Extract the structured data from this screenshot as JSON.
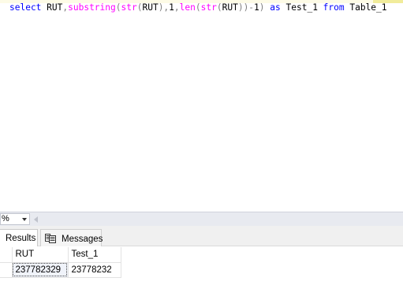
{
  "editor": {
    "query_tokens": [
      {
        "text": "select",
        "kind": "kw"
      },
      {
        "text": " RUT",
        "kind": "plain"
      },
      {
        "text": ",",
        "kind": "op"
      },
      {
        "text": "substring",
        "kind": "fn"
      },
      {
        "text": "(",
        "kind": "op"
      },
      {
        "text": "str",
        "kind": "fn"
      },
      {
        "text": "(",
        "kind": "op"
      },
      {
        "text": "RUT",
        "kind": "plain"
      },
      {
        "text": "),",
        "kind": "op"
      },
      {
        "text": "1",
        "kind": "plain"
      },
      {
        "text": ",",
        "kind": "op"
      },
      {
        "text": "len",
        "kind": "fn"
      },
      {
        "text": "(",
        "kind": "op"
      },
      {
        "text": "str",
        "kind": "fn"
      },
      {
        "text": "(",
        "kind": "op"
      },
      {
        "text": "RUT",
        "kind": "plain"
      },
      {
        "text": "))-",
        "kind": "op"
      },
      {
        "text": "1",
        "kind": "plain"
      },
      {
        "text": ")",
        "kind": "op"
      },
      {
        "text": " ",
        "kind": "plain"
      },
      {
        "text": "as",
        "kind": "kw"
      },
      {
        "text": " Test_1 ",
        "kind": "plain"
      },
      {
        "text": "from",
        "kind": "kw"
      },
      {
        "text": " Table_1",
        "kind": "plain"
      }
    ]
  },
  "zoom": {
    "value": "%"
  },
  "tabs": {
    "results_label": "Results",
    "messages_label": "Messages"
  },
  "grid": {
    "columns": [
      "RUT",
      "Test_1"
    ],
    "rows": [
      {
        "rut": "237782329",
        "test_1": "23778232"
      }
    ]
  },
  "colors": {
    "keyword": "#0000ff",
    "function": "#ff00ff",
    "operator": "#808080",
    "selected_cell_bg": "#f0f3fa"
  },
  "icons": [
    "results-grid-icon",
    "messages-icon",
    "zoom-dropdown-arrow-icon",
    "scroll-left-icon"
  ]
}
